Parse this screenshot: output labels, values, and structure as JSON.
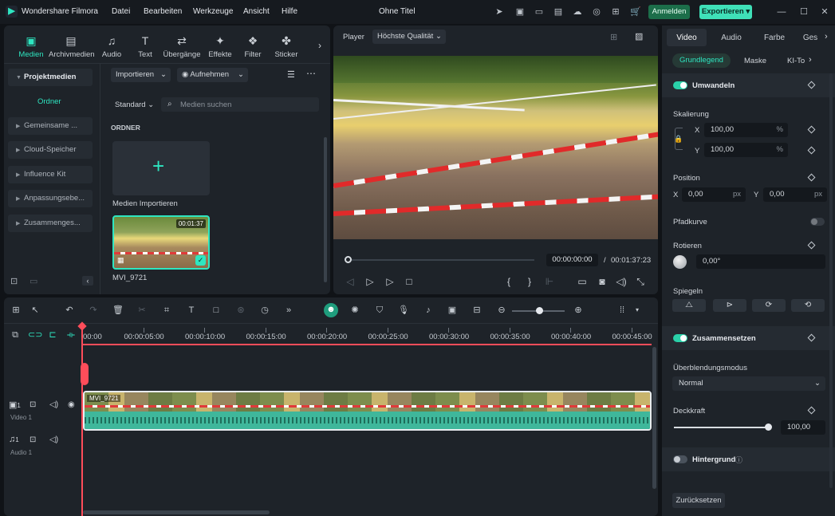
{
  "app": {
    "name": "Wondershare Filmora",
    "doc_title": "Ohne Titel"
  },
  "menu": [
    "Datei",
    "Bearbeiten",
    "Werkzeuge",
    "Ansicht",
    "Hilfe"
  ],
  "actions": {
    "signin": "Anmelden",
    "export": "Exportieren"
  },
  "tools": [
    {
      "label": "Medien",
      "icon": "media-icon"
    },
    {
      "label": "Archivmedien",
      "icon": "archive-icon"
    },
    {
      "label": "Audio",
      "icon": "audio-icon"
    },
    {
      "label": "Text",
      "icon": "text-icon"
    },
    {
      "label": "Übergänge",
      "icon": "transitions-icon"
    },
    {
      "label": "Effekte",
      "icon": "effects-icon"
    },
    {
      "label": "Filter",
      "icon": "filter-icon"
    },
    {
      "label": "Sticker",
      "icon": "sticker-icon"
    }
  ],
  "sidebar": {
    "project_media": "Projektmedien",
    "folder": "Ordner",
    "items": [
      "Gemeinsame ...",
      "Cloud-Speicher",
      "Influence Kit",
      "Anpassungsebe...",
      "Zusammenges..."
    ]
  },
  "media": {
    "import_label": "Importieren",
    "record_label": "Aufnehmen",
    "sort_label": "Standard",
    "search_placeholder": "Medien suchen",
    "folder_heading": "ORDNER",
    "import_card_label": "Medien Importieren",
    "clip": {
      "name": "MVI_9721",
      "duration": "00:01:37"
    }
  },
  "player": {
    "label": "Player",
    "quality": "Höchste Qualität",
    "current_time": "00:00:00:00",
    "separator": "/",
    "total_time": "00:01:37:23",
    "progress": 0.0
  },
  "props": {
    "tabs": [
      "Video",
      "Audio",
      "Farbe",
      "Ges"
    ],
    "subtabs": [
      "Grundlegend",
      "Maske",
      "KI-To"
    ],
    "transform": "Umwandeln",
    "scale": "Skalierung",
    "x_label": "X",
    "y_label": "Y",
    "scale_x": "100,00",
    "scale_y": "100,00",
    "percent": "%",
    "position": "Position",
    "pos_x": "0,00",
    "pos_y": "0,00",
    "px": "px",
    "path_curve": "Pfadkurve",
    "rotate": "Rotieren",
    "rotate_value": "0,00°",
    "mirror": "Spiegeln",
    "compose": "Zusammensetzen",
    "blend_mode": "Überblendungsmodus",
    "blend_value": "Normal",
    "opacity": "Deckkraft",
    "opacity_value": "100,00",
    "opacity_level": 1.0,
    "background": "Hintergrund",
    "reset": "Zurücksetzen"
  },
  "timeline": {
    "ruler": [
      "00:00",
      "00:00:05:00",
      "00:00:10:00",
      "00:00:15:00",
      "00:00:20:00",
      "00:00:25:00",
      "00:00:30:00",
      "00:00:35:00",
      "00:00:40:00",
      "00:00:45:00"
    ],
    "video_track": "Video 1",
    "audio_track": "Audio 1",
    "track_index": "1",
    "clip_label": "MVI_9721"
  },
  "colors": {
    "accent": "#2ee6c1",
    "playhead": "#ff4d5a",
    "export_bg": "#3fe0b8",
    "signin_bg": "#1c6e4a"
  }
}
